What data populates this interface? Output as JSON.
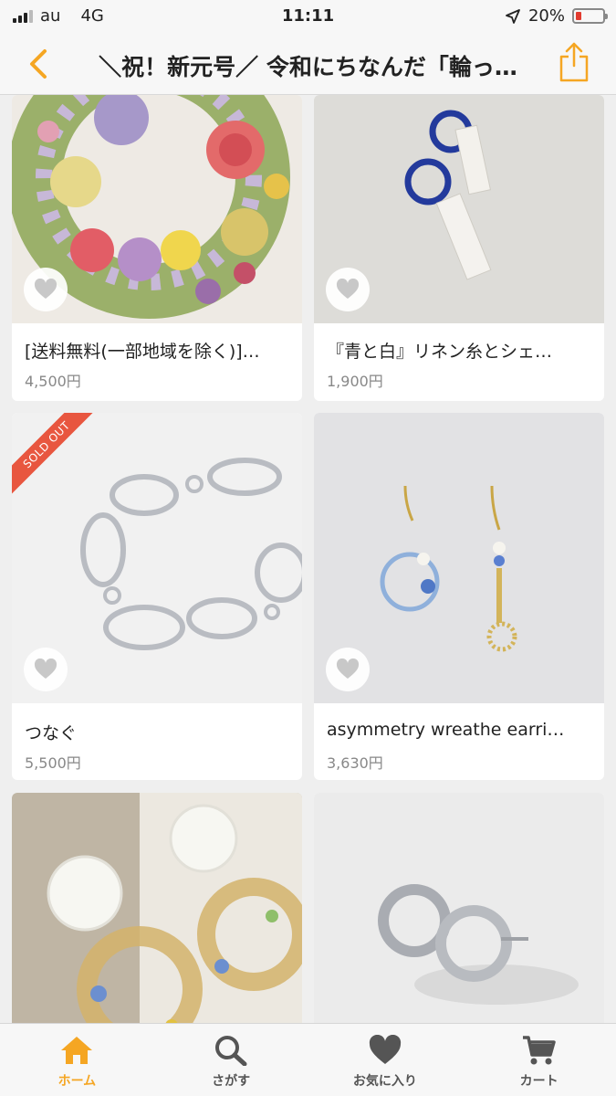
{
  "status_bar": {
    "carrier": "au",
    "network": "4G",
    "time": "11:11",
    "battery_text": "20%",
    "battery_level": 0.2
  },
  "nav": {
    "back_icon": "chevron-left-icon",
    "title": "＼祝！新元号／ 令和にちなんだ「輪っ…",
    "share_icon": "share-icon"
  },
  "products": [
    {
      "title": "[送料無料(一部地域を除く)]…",
      "price": "4,500円",
      "sold_out": false
    },
    {
      "title": "『青と白』リネン糸とシェ…",
      "price": "1,900円",
      "sold_out": false
    },
    {
      "title": "つなぐ",
      "price": "5,500円",
      "sold_out": true,
      "sold_out_label": "SOLD OUT"
    },
    {
      "title": "asymmetry wreathe earri…",
      "price": "3,630円",
      "sold_out": false
    },
    {
      "title": "",
      "price": "",
      "sold_out": false
    },
    {
      "title": "",
      "price": "",
      "sold_out": false
    }
  ],
  "tabs": [
    {
      "label": "ホーム",
      "icon": "home-icon",
      "active": true
    },
    {
      "label": "さがす",
      "icon": "search-icon",
      "active": false
    },
    {
      "label": "お気に入り",
      "icon": "heart-icon",
      "active": false
    },
    {
      "label": "カート",
      "icon": "cart-icon",
      "active": false
    }
  ],
  "colors": {
    "accent": "#f5a623",
    "sold_out": "#e8563f",
    "fav_heart": "#c8c8c8",
    "tab_icon": "#555555"
  }
}
